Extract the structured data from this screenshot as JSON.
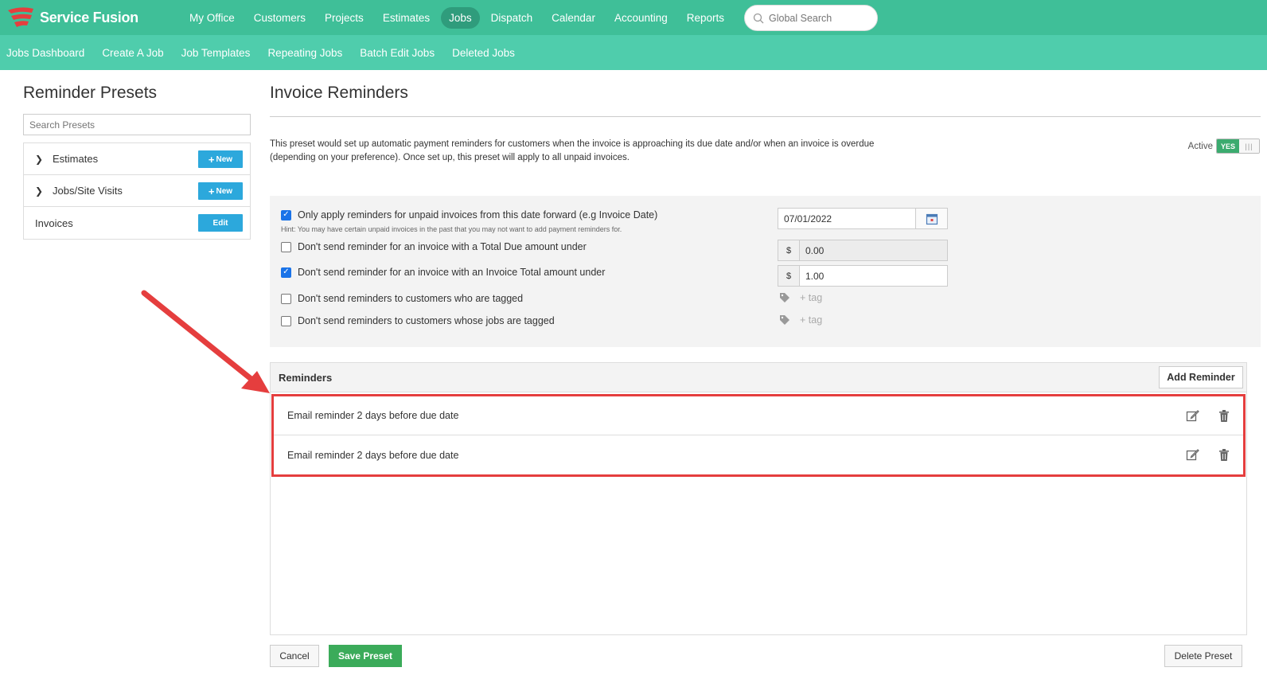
{
  "brand": {
    "name": "Service Fusion",
    "accent": "#3fbf98",
    "logo_color": "#e53e3e"
  },
  "main_nav": [
    {
      "label": "My Office",
      "active": false
    },
    {
      "label": "Customers",
      "active": false
    },
    {
      "label": "Projects",
      "active": false
    },
    {
      "label": "Estimates",
      "active": false
    },
    {
      "label": "Jobs",
      "active": true
    },
    {
      "label": "Dispatch",
      "active": false
    },
    {
      "label": "Calendar",
      "active": false
    },
    {
      "label": "Accounting",
      "active": false
    },
    {
      "label": "Reports",
      "active": false
    }
  ],
  "global_search": {
    "placeholder": "Global Search"
  },
  "sub_nav": [
    "Jobs Dashboard",
    "Create A Job",
    "Job Templates",
    "Repeating Jobs",
    "Batch Edit Jobs",
    "Deleted Jobs"
  ],
  "left": {
    "title": "Reminder Presets",
    "search_placeholder": "Search Presets",
    "presets": [
      {
        "label": "Estimates",
        "button": "New",
        "expandable": true
      },
      {
        "label": "Jobs/Site Visits",
        "button": "New",
        "expandable": true
      },
      {
        "label": "Invoices",
        "button": "Edit",
        "expandable": false
      }
    ]
  },
  "main": {
    "title": "Invoice Reminders",
    "description": "This preset would set up automatic payment reminders for customers when the invoice is approaching its due date and/or when an invoice is overdue (depending on your preference). Once set up, this preset will apply to all unpaid invoices.",
    "active_label": "Active",
    "active_toggle": "YES",
    "options": {
      "date_forward": {
        "label": "Only apply reminders for unpaid invoices from this date forward (e.g Invoice Date)",
        "checked": true,
        "value": "07/01/2022",
        "hint": "Hint: You may have certain unpaid invoices in the past that you may not want to add payment reminders for."
      },
      "total_due": {
        "label": "Don't send reminder for an invoice with a Total Due amount under",
        "checked": false,
        "currency": "$",
        "value": "0.00"
      },
      "invoice_total": {
        "label": "Don't send reminder for an invoice with an Invoice Total amount under",
        "checked": true,
        "currency": "$",
        "value": "1.00"
      },
      "customers_tagged": {
        "label": "Don't send reminders to customers who are tagged",
        "checked": false,
        "tag_placeholder": "+ tag"
      },
      "jobs_tagged": {
        "label": "Don't send reminders to customers whose jobs are tagged",
        "checked": false,
        "tag_placeholder": "+ tag"
      }
    },
    "reminders": {
      "title": "Reminders",
      "add_label": "Add Reminder",
      "items": [
        "Email reminder 2 days before due date",
        "Email reminder 2 days before due date"
      ]
    }
  },
  "footer": {
    "cancel": "Cancel",
    "save": "Save Preset",
    "delete": "Delete Preset"
  },
  "colors": {
    "highlight": "#e53e3e",
    "save_green": "#3bab5a",
    "button_blue": "#2ca8dc"
  }
}
